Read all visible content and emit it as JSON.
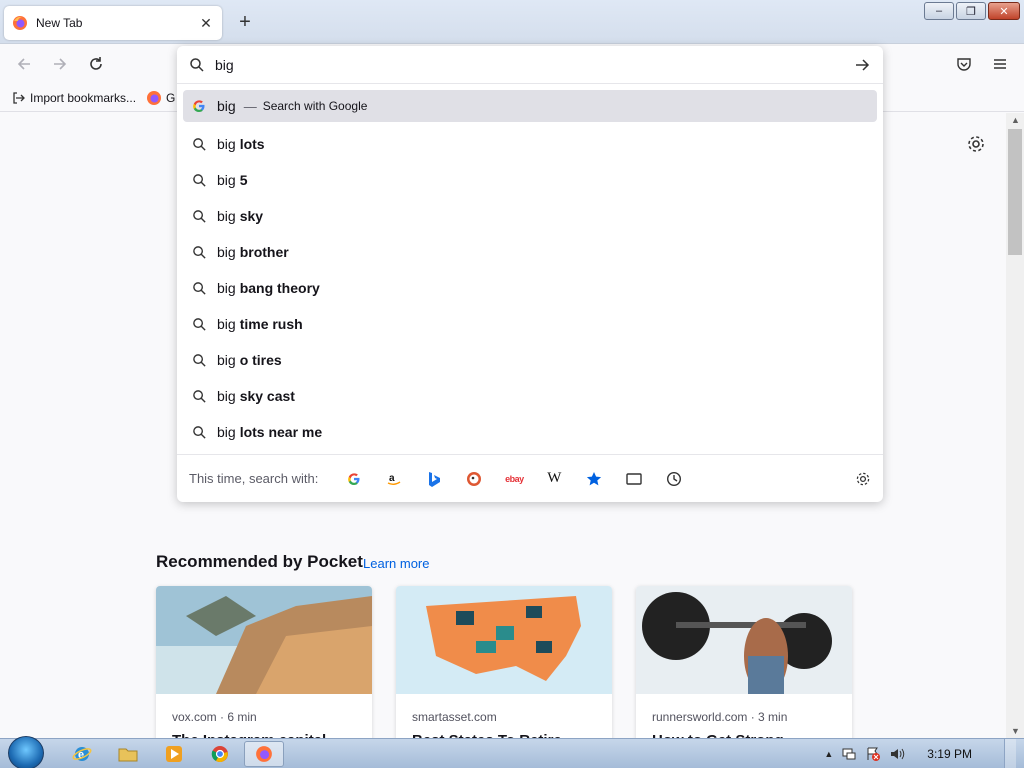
{
  "window": {
    "tab_title": "New Tab",
    "new_tab_symbol": "+",
    "minimize_symbol": "–",
    "maximize_symbol": "❐",
    "close_symbol": "✕"
  },
  "bookmarks": {
    "import_label": "Import bookmarks...",
    "second_label": "G"
  },
  "urlbar": {
    "value": "big",
    "results": [
      {
        "typed": "big",
        "suggestion": "",
        "action": "Search with Google",
        "icon": "google-icon",
        "selected": true
      },
      {
        "typed": "big",
        "suggestion": "lots",
        "icon": "search-icon"
      },
      {
        "typed": "big",
        "suggestion": "5",
        "icon": "search-icon"
      },
      {
        "typed": "big",
        "suggestion": "sky",
        "icon": "search-icon"
      },
      {
        "typed": "big",
        "suggestion": "brother",
        "icon": "search-icon"
      },
      {
        "typed": "big",
        "suggestion": "bang theory",
        "icon": "search-icon"
      },
      {
        "typed": "big",
        "suggestion": "time rush",
        "icon": "search-icon"
      },
      {
        "typed": "big",
        "suggestion": "o tires",
        "icon": "search-icon"
      },
      {
        "typed": "big",
        "suggestion": "sky cast",
        "icon": "search-icon"
      },
      {
        "typed": "big",
        "suggestion": "lots near me",
        "icon": "search-icon"
      }
    ],
    "dash": "—",
    "oneoff_label": "This time, search with:",
    "oneoff_engines": [
      "google",
      "amazon",
      "bing",
      "duckduckgo",
      "ebay",
      "wikipedia",
      "bookmarks",
      "tabs",
      "history"
    ],
    "wikipedia_glyph": "W",
    "ebay_glyph": "ebay"
  },
  "pocket": {
    "title": "Recommended by Pocket",
    "learn_more": "Learn more",
    "cards": [
      {
        "source": "vox.com · 6 min",
        "headline": "The Instagram capital..."
      },
      {
        "source": "smartasset.com",
        "headline": "Best States To Retire..."
      },
      {
        "source": "runnersworld.com · 3 min",
        "headline": "How to Get Strong..."
      }
    ]
  },
  "taskbar": {
    "clock": "3:19 PM"
  },
  "colors": {
    "accent": "#0061e0",
    "selected_row": "#e0e0e6"
  }
}
